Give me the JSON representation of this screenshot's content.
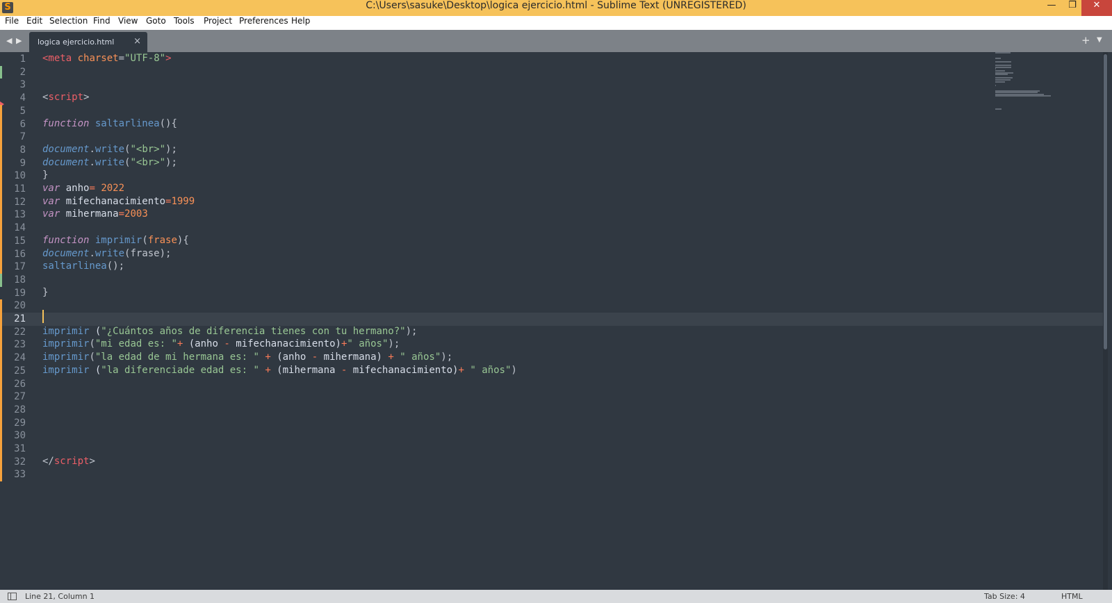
{
  "window": {
    "title": "C:\\Users\\sasuke\\Desktop\\logica ejercicio.html - Sublime Text (UNREGISTERED)",
    "app_icon": "sublime-logo",
    "minimize_glyph": "—",
    "restore_glyph": "❐",
    "close_glyph": "✕"
  },
  "menu": [
    "File",
    "Edit",
    "Selection",
    "Find",
    "View",
    "Goto",
    "Tools",
    "Project",
    "Preferences",
    "Help"
  ],
  "tabs": {
    "back_glyph": "◀",
    "forward_glyph": "▶",
    "active_tab": "logica ejercicio.html",
    "close_glyph": "×",
    "new_tab_glyph": "+",
    "tab_list_glyph": "▼"
  },
  "editor": {
    "line_numbers": [
      "1",
      "2",
      "3",
      "4",
      "5",
      "6",
      "7",
      "8",
      "9",
      "10",
      "11",
      "12",
      "13",
      "14",
      "15",
      "16",
      "17",
      "18",
      "19",
      "20",
      "21",
      "22",
      "23",
      "24",
      "25",
      "26",
      "27",
      "28",
      "29",
      "30",
      "31",
      "32",
      "33"
    ],
    "current_line": 21,
    "colors": {
      "background": "#303841",
      "tag": "#ec5f67",
      "string": "#99c794",
      "keyword": "#c594c5",
      "function": "#6699cc",
      "number": "#f99157",
      "modified_mark": "#f6a23c",
      "added_mark": "#88c08d"
    },
    "lines": [
      [
        [
          "tag",
          "<meta"
        ],
        [
          "plain",
          " "
        ],
        [
          "attr",
          "charset"
        ],
        [
          "punc",
          "="
        ],
        [
          "str",
          "\"UTF-8\""
        ],
        [
          "tag",
          ">"
        ]
      ],
      [],
      [],
      [
        [
          "punc",
          "<"
        ],
        [
          "tag",
          "script"
        ],
        [
          "punc",
          ">"
        ]
      ],
      [],
      [
        [
          "kw",
          "function"
        ],
        [
          "plain",
          " "
        ],
        [
          "fn",
          "saltarlinea"
        ],
        [
          "punc",
          "(){"
        ]
      ],
      [],
      [
        [
          "obj",
          "document"
        ],
        [
          "punc",
          "."
        ],
        [
          "fn",
          "write"
        ],
        [
          "punc",
          "("
        ],
        [
          "str",
          "\"<br>\""
        ],
        [
          "punc",
          ");"
        ]
      ],
      [
        [
          "obj",
          "document"
        ],
        [
          "punc",
          "."
        ],
        [
          "fn",
          "write"
        ],
        [
          "punc",
          "("
        ],
        [
          "str",
          "\"<br>\""
        ],
        [
          "punc",
          ");"
        ]
      ],
      [
        [
          "punc",
          "}"
        ]
      ],
      [
        [
          "kw",
          "var"
        ],
        [
          "plain",
          " anho"
        ],
        [
          "op",
          "="
        ],
        [
          "plain",
          " "
        ],
        [
          "num",
          "2022"
        ]
      ],
      [
        [
          "kw",
          "var"
        ],
        [
          "plain",
          " mifechanacimiento"
        ],
        [
          "op",
          "="
        ],
        [
          "num",
          "1999"
        ]
      ],
      [
        [
          "kw",
          "var"
        ],
        [
          "plain",
          " mihermana"
        ],
        [
          "op",
          "="
        ],
        [
          "num",
          "2003"
        ]
      ],
      [],
      [
        [
          "kw",
          "function"
        ],
        [
          "plain",
          " "
        ],
        [
          "fn",
          "imprimir"
        ],
        [
          "punc",
          "("
        ],
        [
          "param",
          "frase"
        ],
        [
          "punc",
          "){"
        ]
      ],
      [
        [
          "obj",
          "document"
        ],
        [
          "punc",
          "."
        ],
        [
          "fn",
          "write"
        ],
        [
          "punc",
          "(frase);"
        ]
      ],
      [
        [
          "fn",
          "saltarlinea"
        ],
        [
          "punc",
          "();"
        ]
      ],
      [],
      [
        [
          "punc",
          "}"
        ]
      ],
      [],
      [],
      [
        [
          "fn",
          "imprimir"
        ],
        [
          "plain",
          " ("
        ],
        [
          "str",
          "\"¿Cuántos años de diferencia tienes con tu hermano?\""
        ],
        [
          "punc",
          ");"
        ]
      ],
      [
        [
          "fn",
          "imprimir"
        ],
        [
          "punc",
          "("
        ],
        [
          "str",
          "\"mi edad es: \""
        ],
        [
          "op",
          "+"
        ],
        [
          "plain",
          " (anho "
        ],
        [
          "op",
          "-"
        ],
        [
          "plain",
          " mifechanacimiento)"
        ],
        [
          "op",
          "+"
        ],
        [
          "str",
          "\" años\""
        ],
        [
          "punc",
          ");"
        ]
      ],
      [
        [
          "fn",
          "imprimir"
        ],
        [
          "punc",
          "("
        ],
        [
          "str",
          "\"la edad de mi hermana es: \""
        ],
        [
          "plain",
          " "
        ],
        [
          "op",
          "+"
        ],
        [
          "plain",
          " (anho "
        ],
        [
          "op",
          "-"
        ],
        [
          "plain",
          " mihermana) "
        ],
        [
          "op",
          "+"
        ],
        [
          "plain",
          " "
        ],
        [
          "str",
          "\" años\""
        ],
        [
          "punc",
          ");"
        ]
      ],
      [
        [
          "fn",
          "imprimir"
        ],
        [
          "plain",
          " ("
        ],
        [
          "str",
          "\"la diferenciade edad es: \""
        ],
        [
          "plain",
          " "
        ],
        [
          "op",
          "+"
        ],
        [
          "plain",
          " (mihermana "
        ],
        [
          "op",
          "-"
        ],
        [
          "plain",
          " mifechanacimiento)"
        ],
        [
          "op",
          "+"
        ],
        [
          "plain",
          " "
        ],
        [
          "str",
          "\" años\""
        ],
        [
          "punc",
          ")"
        ]
      ],
      [],
      [],
      [],
      [],
      [],
      [],
      [
        [
          "punc",
          "</"
        ],
        [
          "tag",
          "script"
        ],
        [
          "punc",
          ">"
        ]
      ],
      []
    ]
  },
  "status": {
    "position": "Line 21, Column 1",
    "tab_size": "Tab Size: 4",
    "syntax": "HTML"
  }
}
